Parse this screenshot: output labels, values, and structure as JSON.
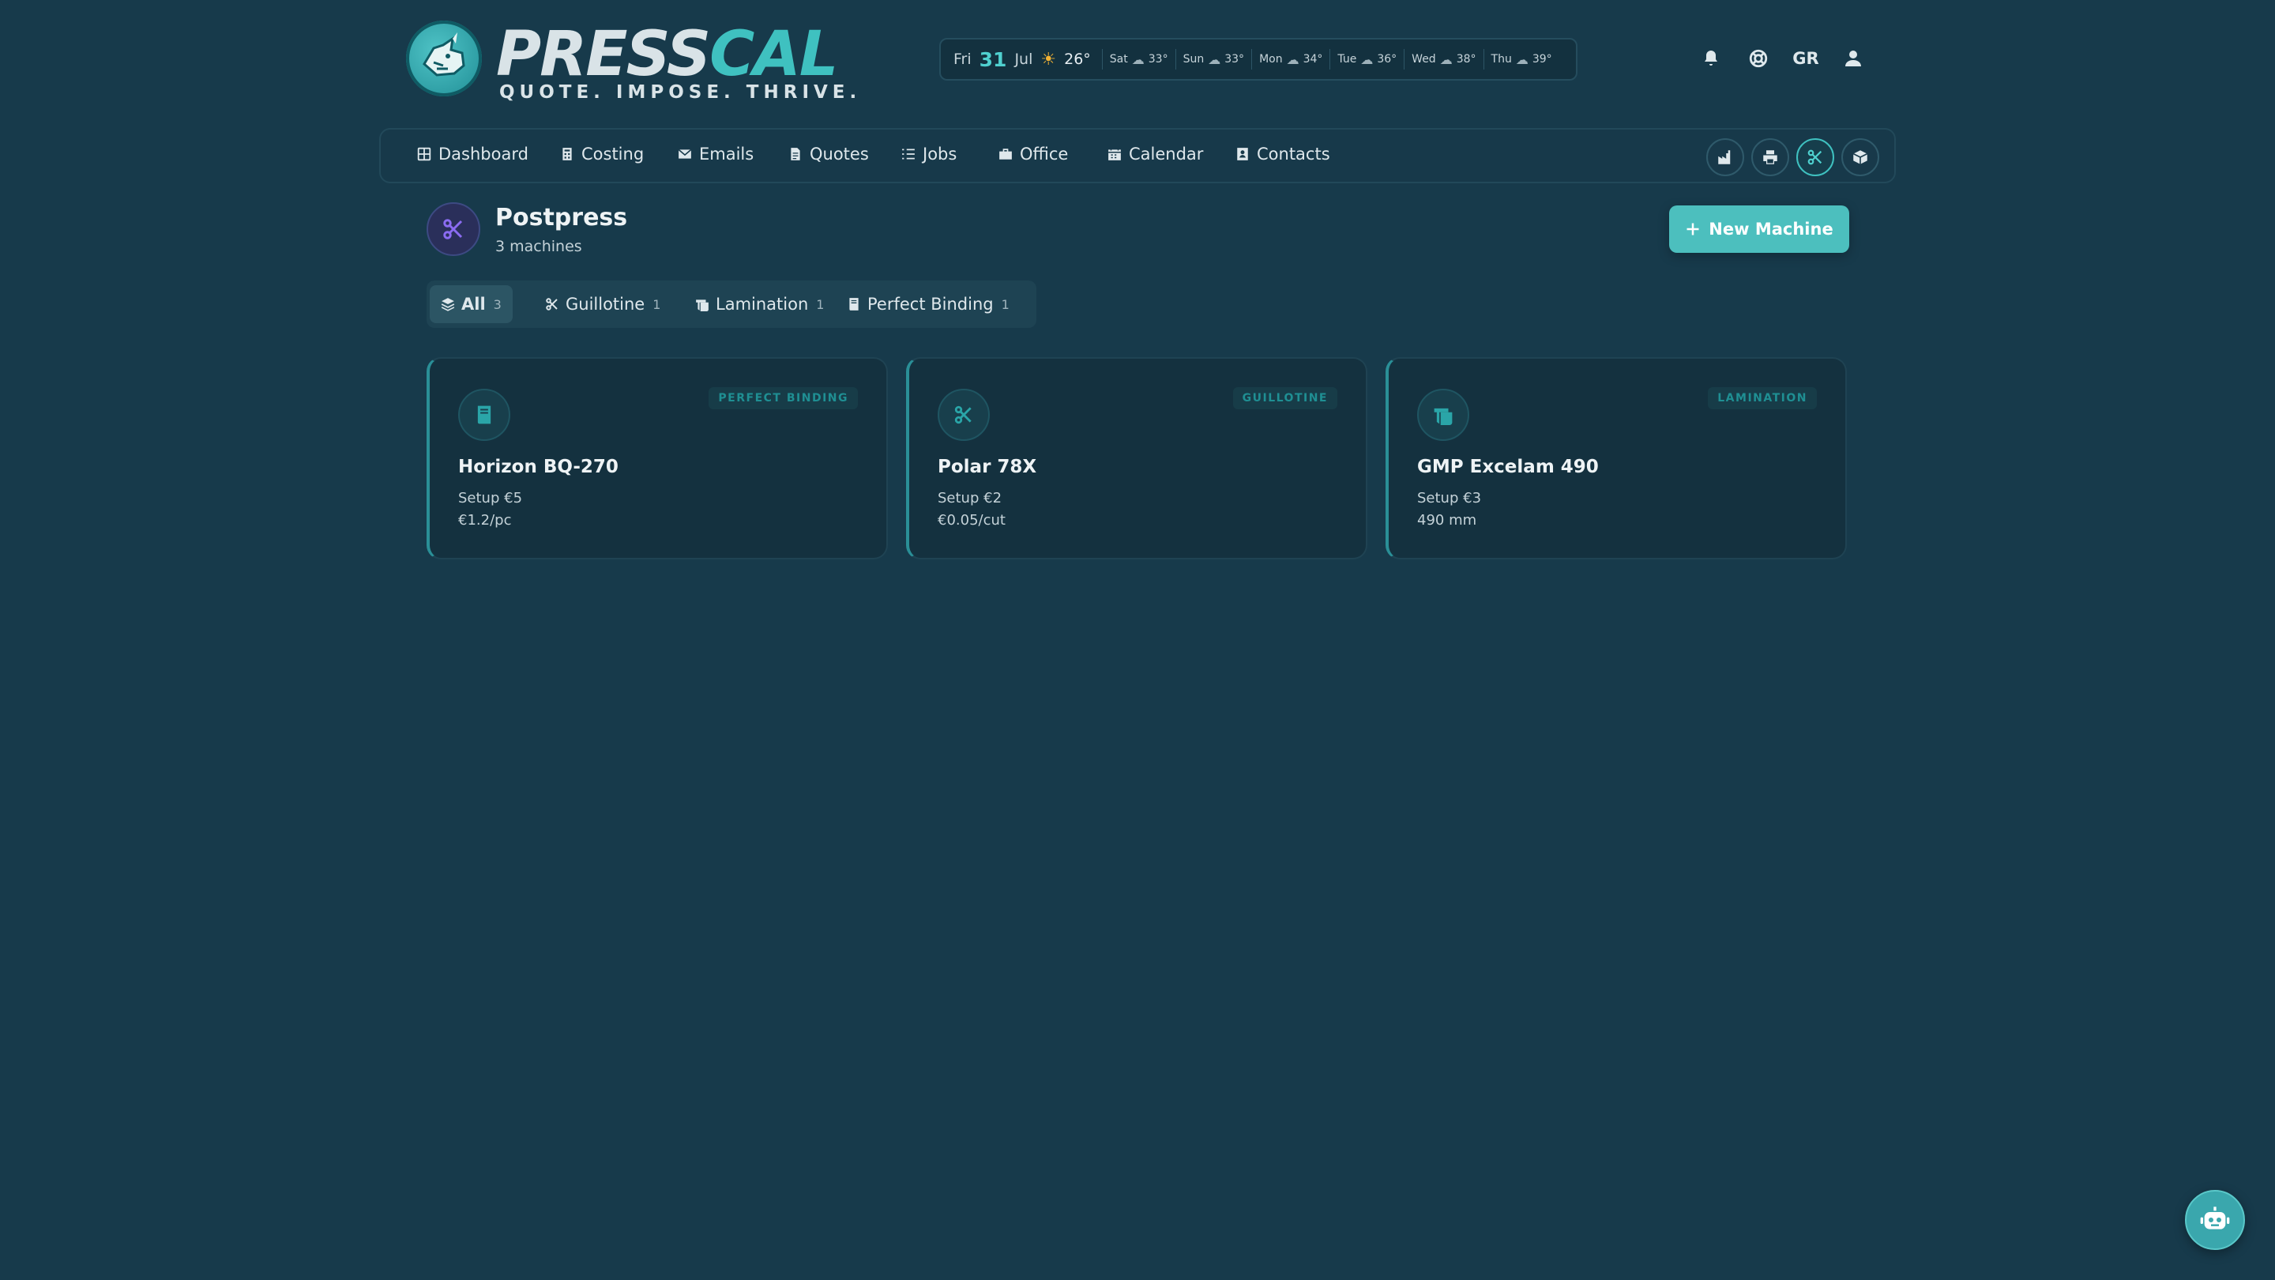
{
  "brand": {
    "name_part1": "PRESS",
    "name_part2": "CAL",
    "tagline": "QUOTE. IMPOSE. THRIVE."
  },
  "weather": {
    "today": {
      "day": "Fri",
      "date": "31",
      "month": "Jul",
      "icon": "sun-icon",
      "temp": "26°"
    },
    "forecast": [
      {
        "day": "Sat",
        "icon": "cloud-sun-icon",
        "temp": "33°"
      },
      {
        "day": "Sun",
        "icon": "cloud-sun-icon",
        "temp": "33°"
      },
      {
        "day": "Mon",
        "icon": "cloud-sun-icon",
        "temp": "34°"
      },
      {
        "day": "Tue",
        "icon": "cloud-sun-icon",
        "temp": "36°"
      },
      {
        "day": "Wed",
        "icon": "cloud-sun-icon",
        "temp": "38°"
      },
      {
        "day": "Thu",
        "icon": "cloud-sun-icon",
        "temp": "39°"
      }
    ]
  },
  "header": {
    "language": "GR",
    "icons": [
      "bell-icon",
      "lifebuoy-icon",
      "user-icon"
    ]
  },
  "nav": {
    "items": [
      {
        "label": "Dashboard",
        "icon": "grid-icon"
      },
      {
        "label": "Costing",
        "icon": "calculator-icon"
      },
      {
        "label": "Emails",
        "icon": "envelope-icon"
      },
      {
        "label": "Quotes",
        "icon": "document-icon"
      },
      {
        "label": "Jobs",
        "icon": "list-icon"
      },
      {
        "label": "Office",
        "icon": "briefcase-icon"
      },
      {
        "label": "Calendar",
        "icon": "calendar-icon"
      },
      {
        "label": "Contacts",
        "icon": "address-book-icon"
      }
    ],
    "tools": [
      {
        "icon": "factory-icon",
        "active": false
      },
      {
        "icon": "printer-icon",
        "active": false
      },
      {
        "icon": "scissors-icon",
        "active": true
      },
      {
        "icon": "box-icon",
        "active": false
      }
    ]
  },
  "page": {
    "title": "Postpress",
    "subtitle": "3 machines",
    "icon": "scissors-icon",
    "new_button": "New Machine"
  },
  "filters": [
    {
      "label": "All",
      "count": "3",
      "icon": "layers-icon",
      "active": true
    },
    {
      "label": "Guillotine",
      "count": "1",
      "icon": "scissors-icon",
      "active": false
    },
    {
      "label": "Lamination",
      "count": "1",
      "icon": "scroll-icon",
      "active": false
    },
    {
      "label": "Perfect Binding",
      "count": "1",
      "icon": "book-icon",
      "active": false
    }
  ],
  "machines": [
    {
      "name": "Horizon BQ-270",
      "badge": "PERFECT BINDING",
      "icon": "book-icon",
      "line1": "Setup €5",
      "line2": "€1.2/pc"
    },
    {
      "name": "Polar 78X",
      "badge": "GUILLOTINE",
      "icon": "scissors-icon",
      "line1": "Setup €2",
      "line2": "€0.05/cut"
    },
    {
      "name": "GMP Excelam 490",
      "badge": "LAMINATION",
      "icon": "scroll-icon",
      "line1": "Setup €3",
      "line2": "490 mm"
    }
  ],
  "colors": {
    "background": "#173a4b",
    "accent": "#4cbfbe",
    "postpress_icon": "#8b6cf2"
  }
}
